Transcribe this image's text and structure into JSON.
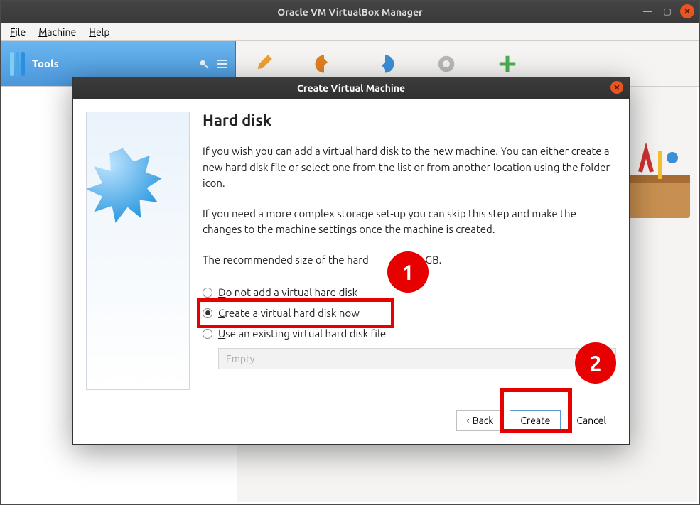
{
  "window": {
    "title": "Oracle VM VirtualBox Manager"
  },
  "menubar": {
    "file": "File",
    "machine": "Machine",
    "help": "Help"
  },
  "toolbar": {
    "tools_label": "Tools"
  },
  "dialog": {
    "title": "Create Virtual Machine",
    "heading": "Hard disk",
    "para1": "If you wish you can add a virtual hard disk to the new machine. You can either create a new hard disk file or select one from the list or from another location using the folder icon.",
    "para2": "If you need a more complex storage set-up you can skip this step and make the changes to the machine settings once the machine is created.",
    "para3_pre": "The recommended size of the hard ",
    "para3_post": ",00 GB.",
    "radios": {
      "none": "Do not add a virtual hard disk",
      "create": "Create a virtual hard disk now",
      "existing": "Use an existing virtual hard disk file"
    },
    "existing_placeholder": "Empty",
    "buttons": {
      "back": "Back",
      "create": "Create",
      "cancel": "Cancel"
    }
  },
  "annotations": {
    "1": "1",
    "2": "2"
  }
}
